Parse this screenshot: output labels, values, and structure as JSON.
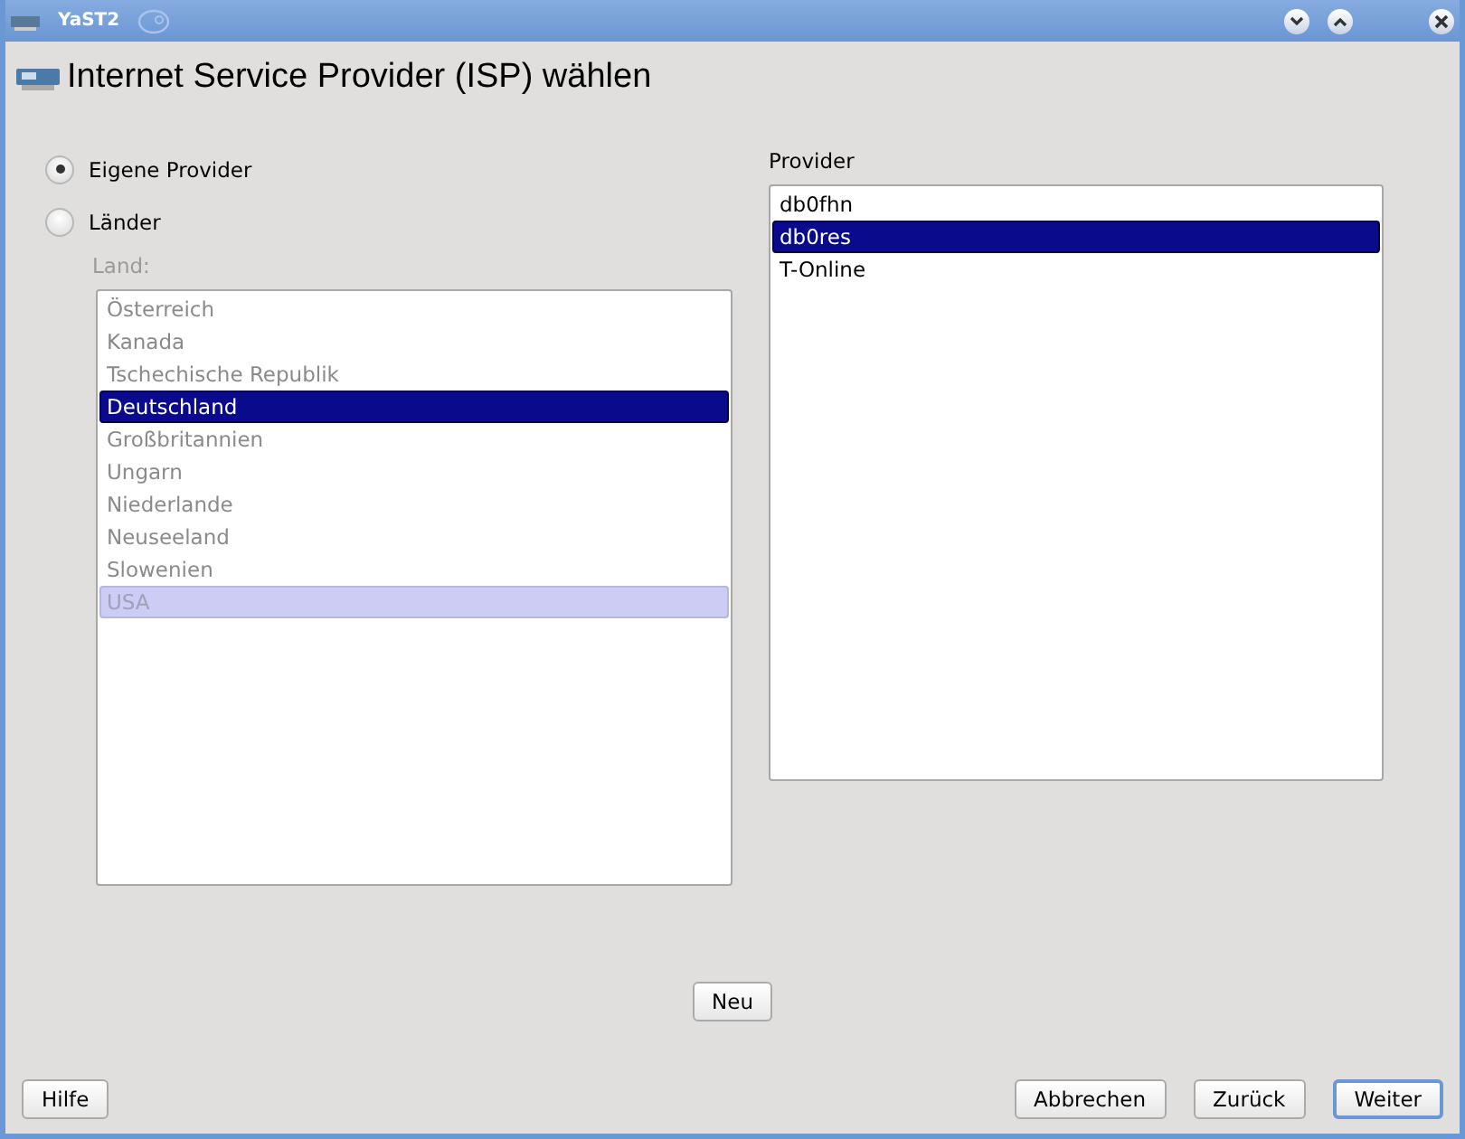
{
  "window": {
    "title": "YaST2"
  },
  "heading": "Internet Service Provider (ISP) wählen",
  "source_options": [
    {
      "label": "Eigene Provider",
      "selected": true
    },
    {
      "label": "Länder",
      "selected": false
    }
  ],
  "country_list": {
    "label": "Land:",
    "disabled": true,
    "items": [
      {
        "label": "Österreich",
        "selected": false,
        "highlighted": false
      },
      {
        "label": "Kanada",
        "selected": false,
        "highlighted": false
      },
      {
        "label": "Tschechische Republik",
        "selected": false,
        "highlighted": false
      },
      {
        "label": "Deutschland",
        "selected": true,
        "highlighted": false
      },
      {
        "label": "Großbritannien",
        "selected": false,
        "highlighted": false
      },
      {
        "label": "Ungarn",
        "selected": false,
        "highlighted": false
      },
      {
        "label": "Niederlande",
        "selected": false,
        "highlighted": false
      },
      {
        "label": "Neuseeland",
        "selected": false,
        "highlighted": false
      },
      {
        "label": "Slowenien",
        "selected": false,
        "highlighted": false
      },
      {
        "label": "USA",
        "selected": false,
        "highlighted": true
      }
    ]
  },
  "provider_list": {
    "label": "Provider",
    "items": [
      {
        "label": "db0fhn",
        "selected": false
      },
      {
        "label": "db0res",
        "selected": true
      },
      {
        "label": "T-Online",
        "selected": false
      }
    ]
  },
  "new_button": "Neu",
  "footer_buttons": [
    {
      "label": "Hilfe",
      "kind": "left",
      "default": false
    },
    {
      "label": "Abbrechen",
      "kind": "right",
      "default": false
    },
    {
      "label": "Zurück",
      "kind": "right",
      "default": false
    },
    {
      "label": "Weiter",
      "kind": "right",
      "default": true
    }
  ]
}
